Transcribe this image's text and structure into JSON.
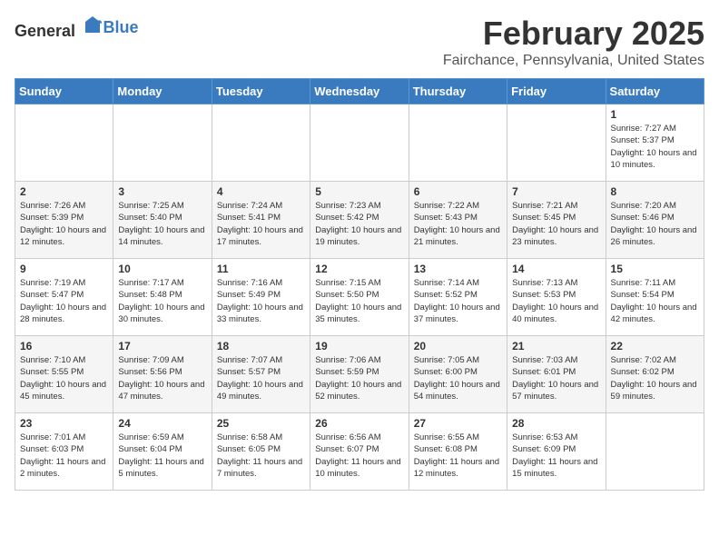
{
  "header": {
    "logo_general": "General",
    "logo_blue": "Blue",
    "month_year": "February 2025",
    "location": "Fairchance, Pennsylvania, United States"
  },
  "weekdays": [
    "Sunday",
    "Monday",
    "Tuesday",
    "Wednesday",
    "Thursday",
    "Friday",
    "Saturday"
  ],
  "weeks": [
    [
      {
        "day": "",
        "sunrise": "",
        "sunset": "",
        "daylight": ""
      },
      {
        "day": "",
        "sunrise": "",
        "sunset": "",
        "daylight": ""
      },
      {
        "day": "",
        "sunrise": "",
        "sunset": "",
        "daylight": ""
      },
      {
        "day": "",
        "sunrise": "",
        "sunset": "",
        "daylight": ""
      },
      {
        "day": "",
        "sunrise": "",
        "sunset": "",
        "daylight": ""
      },
      {
        "day": "",
        "sunrise": "",
        "sunset": "",
        "daylight": ""
      },
      {
        "day": "1",
        "sunrise": "7:27 AM",
        "sunset": "5:37 PM",
        "daylight": "10 hours and 10 minutes."
      }
    ],
    [
      {
        "day": "2",
        "sunrise": "7:26 AM",
        "sunset": "5:39 PM",
        "daylight": "10 hours and 12 minutes."
      },
      {
        "day": "3",
        "sunrise": "7:25 AM",
        "sunset": "5:40 PM",
        "daylight": "10 hours and 14 minutes."
      },
      {
        "day": "4",
        "sunrise": "7:24 AM",
        "sunset": "5:41 PM",
        "daylight": "10 hours and 17 minutes."
      },
      {
        "day": "5",
        "sunrise": "7:23 AM",
        "sunset": "5:42 PM",
        "daylight": "10 hours and 19 minutes."
      },
      {
        "day": "6",
        "sunrise": "7:22 AM",
        "sunset": "5:43 PM",
        "daylight": "10 hours and 21 minutes."
      },
      {
        "day": "7",
        "sunrise": "7:21 AM",
        "sunset": "5:45 PM",
        "daylight": "10 hours and 23 minutes."
      },
      {
        "day": "8",
        "sunrise": "7:20 AM",
        "sunset": "5:46 PM",
        "daylight": "10 hours and 26 minutes."
      }
    ],
    [
      {
        "day": "9",
        "sunrise": "7:19 AM",
        "sunset": "5:47 PM",
        "daylight": "10 hours and 28 minutes."
      },
      {
        "day": "10",
        "sunrise": "7:17 AM",
        "sunset": "5:48 PM",
        "daylight": "10 hours and 30 minutes."
      },
      {
        "day": "11",
        "sunrise": "7:16 AM",
        "sunset": "5:49 PM",
        "daylight": "10 hours and 33 minutes."
      },
      {
        "day": "12",
        "sunrise": "7:15 AM",
        "sunset": "5:50 PM",
        "daylight": "10 hours and 35 minutes."
      },
      {
        "day": "13",
        "sunrise": "7:14 AM",
        "sunset": "5:52 PM",
        "daylight": "10 hours and 37 minutes."
      },
      {
        "day": "14",
        "sunrise": "7:13 AM",
        "sunset": "5:53 PM",
        "daylight": "10 hours and 40 minutes."
      },
      {
        "day": "15",
        "sunrise": "7:11 AM",
        "sunset": "5:54 PM",
        "daylight": "10 hours and 42 minutes."
      }
    ],
    [
      {
        "day": "16",
        "sunrise": "7:10 AM",
        "sunset": "5:55 PM",
        "daylight": "10 hours and 45 minutes."
      },
      {
        "day": "17",
        "sunrise": "7:09 AM",
        "sunset": "5:56 PM",
        "daylight": "10 hours and 47 minutes."
      },
      {
        "day": "18",
        "sunrise": "7:07 AM",
        "sunset": "5:57 PM",
        "daylight": "10 hours and 49 minutes."
      },
      {
        "day": "19",
        "sunrise": "7:06 AM",
        "sunset": "5:59 PM",
        "daylight": "10 hours and 52 minutes."
      },
      {
        "day": "20",
        "sunrise": "7:05 AM",
        "sunset": "6:00 PM",
        "daylight": "10 hours and 54 minutes."
      },
      {
        "day": "21",
        "sunrise": "7:03 AM",
        "sunset": "6:01 PM",
        "daylight": "10 hours and 57 minutes."
      },
      {
        "day": "22",
        "sunrise": "7:02 AM",
        "sunset": "6:02 PM",
        "daylight": "10 hours and 59 minutes."
      }
    ],
    [
      {
        "day": "23",
        "sunrise": "7:01 AM",
        "sunset": "6:03 PM",
        "daylight": "11 hours and 2 minutes."
      },
      {
        "day": "24",
        "sunrise": "6:59 AM",
        "sunset": "6:04 PM",
        "daylight": "11 hours and 5 minutes."
      },
      {
        "day": "25",
        "sunrise": "6:58 AM",
        "sunset": "6:05 PM",
        "daylight": "11 hours and 7 minutes."
      },
      {
        "day": "26",
        "sunrise": "6:56 AM",
        "sunset": "6:07 PM",
        "daylight": "11 hours and 10 minutes."
      },
      {
        "day": "27",
        "sunrise": "6:55 AM",
        "sunset": "6:08 PM",
        "daylight": "11 hours and 12 minutes."
      },
      {
        "day": "28",
        "sunrise": "6:53 AM",
        "sunset": "6:09 PM",
        "daylight": "11 hours and 15 minutes."
      },
      {
        "day": "",
        "sunrise": "",
        "sunset": "",
        "daylight": ""
      }
    ]
  ]
}
